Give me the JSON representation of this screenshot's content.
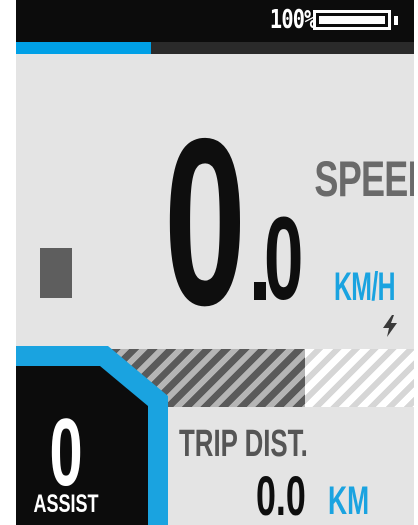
{
  "status_bar": {
    "battery_percent_text": "100%",
    "battery_level_fraction": 1.0,
    "battery_icon": "battery-full-icon"
  },
  "progress": {
    "fraction": 0.34,
    "color": "#00a0e6"
  },
  "speed": {
    "label": "SPEED",
    "integer": "0",
    "decimal": "0",
    "unit": "KM/H",
    "charging_icon": "lightning-bolt-icon"
  },
  "power_bar": {
    "fraction": 0.64
  },
  "assist": {
    "value": "0",
    "label": "ASSIST"
  },
  "trip": {
    "label": "TRIP DIST.",
    "value": "0.0",
    "unit": "KM"
  },
  "colors": {
    "accent": "#1aa3e0",
    "background": "#e4e4e4",
    "dark": "#0e0e0e",
    "gray_text": "#6a6a6a"
  }
}
